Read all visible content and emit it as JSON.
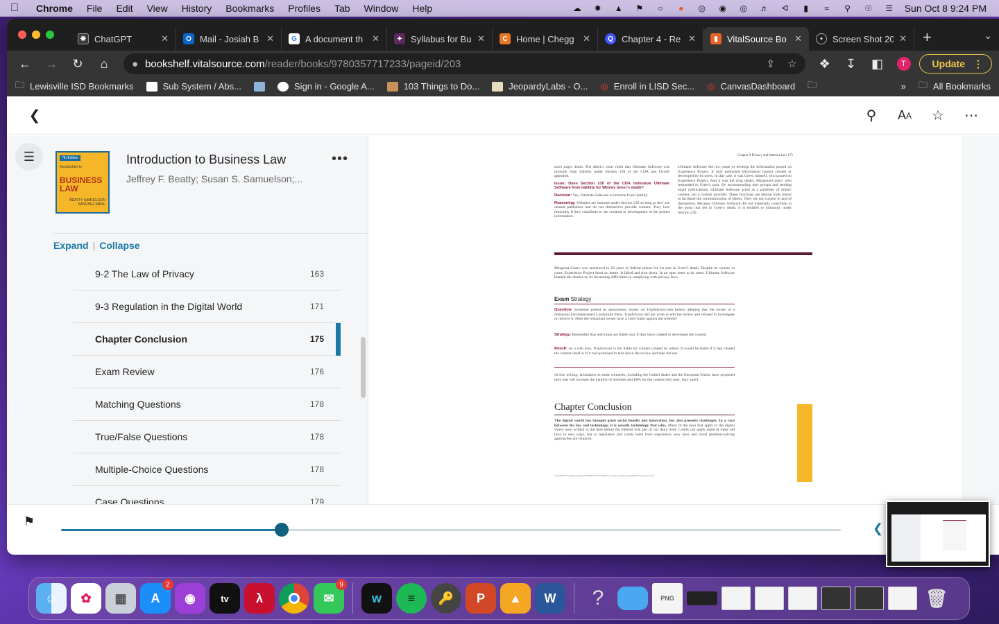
{
  "menubar": {
    "app_name": "Chrome",
    "items": [
      "File",
      "Edit",
      "View",
      "History",
      "Bookmarks",
      "Profiles",
      "Tab",
      "Window",
      "Help"
    ],
    "clock": "Sun Oct 8  9:24 PM"
  },
  "tabs": [
    {
      "title": "ChatGPT",
      "favicon": "chatgpt-icon",
      "color": "#444"
    },
    {
      "title": "Mail - Josiah B",
      "favicon": "outlook-icon",
      "color": "#0a64c9"
    },
    {
      "title": "A document th",
      "favicon": "google-icon",
      "color": "#fff"
    },
    {
      "title": "Syllabus for Bu",
      "favicon": "canvas-icon",
      "color": "#5a2a5e"
    },
    {
      "title": "Home | Chegg",
      "favicon": "chegg-icon",
      "color": "#e87722"
    },
    {
      "title": "Chapter 4 - Re",
      "favicon": "quizlet-icon",
      "color": "#4255ff"
    },
    {
      "title": "VitalSource Bo",
      "favicon": "vitalsource-icon",
      "color": "#e8622a"
    },
    {
      "title": "Screen Shot 20",
      "favicon": "globe-icon",
      "color": "#666"
    }
  ],
  "address": {
    "host": "bookshelf.vitalsource.com",
    "path": "/reader/books/9780357717233/pageid/203"
  },
  "profile_initial": "T",
  "update_label": "Update",
  "bookmarks": [
    {
      "label": "Lewisville ISD Bookmarks",
      "icon": "folder-icon"
    },
    {
      "label": "Sub System / Abs...",
      "icon": "substitute-icon"
    },
    {
      "label": "",
      "icon": "bookmark-app-icon"
    },
    {
      "label": "Sign in - Google A...",
      "icon": "google-icon"
    },
    {
      "label": "103 Things to Do...",
      "icon": "image-icon"
    },
    {
      "label": "JeopardyLabs - O...",
      "icon": "jeopardy-icon"
    },
    {
      "label": "Enroll in LISD Sec...",
      "icon": "dotted-circle-icon"
    },
    {
      "label": "CanvasDashboard",
      "icon": "dotted-circle-icon"
    },
    {
      "label": "",
      "icon": "folder-icon"
    }
  ],
  "bookmarks_more": "»",
  "all_bookmarks_label": "All Bookmarks",
  "book": {
    "title": "Introduction to Business Law",
    "authors": "Jeffrey F. Beatty; Susan S. Samuelson;...",
    "cover_edition": "7th Edition",
    "cover_sub": "Introduction to",
    "cover_title": "BUSINESS LAW",
    "cover_authors": "BEATTY SAMUELSON SÁNCHEZ ABRIL"
  },
  "toc_controls": {
    "expand": "Expand",
    "collapse": "Collapse",
    "separator": "|"
  },
  "toc": [
    {
      "label": "9-2 The Law of Privacy",
      "page": "163",
      "current": false
    },
    {
      "label": "9-3 Regulation in the Digital World",
      "page": "171",
      "current": false
    },
    {
      "label": "Chapter Conclusion",
      "page": "175",
      "current": true
    },
    {
      "label": "Exam Review",
      "page": "176",
      "current": false
    },
    {
      "label": "Matching Questions",
      "page": "178",
      "current": false
    },
    {
      "label": "True/False Questions",
      "page": "178",
      "current": false
    },
    {
      "label": "Multiple-Choice Questions",
      "page": "178",
      "current": false
    },
    {
      "label": "Case Questions",
      "page": "179",
      "current": false
    }
  ],
  "book_page": {
    "running_head": "Chapter 9    Privacy and Internet Law        175",
    "left_col_top": "son's tragic death. The district court ruled that Ultimate Software was immune from liability under Section 230 of the CDA and Dyroff appealed.",
    "issue_label": "Issue:",
    "issue_text": "Does Section 230 of the CDA immunize Ultimate Software from liability for Wesley Greer's death?",
    "decision_label": "Decision:",
    "decision_text": "Yes, Ultimate Software is immune from liability.",
    "reasoning_label": "Reasoning:",
    "reasoning_text": "Websites are immune under Section 230 so long as they are neutral publishers and do not themselves provide content. They lose immunity if they contribute to the creation or development of the posted information.",
    "right_col": "Ultimate Software did not create or develop the information posted on Experience Project. It only published information (posts) created or developed by its users. In this case, it was Greer, himself, who posted on Experience Project. And it was the drug dealer, Margenat-Castro, who responded to Greer's post. By recommending user groups and sending email notifications, Ultimate Software acted as a publisher of others' content, not a content provider. These functions are neutral tools meant to facilitate the communication of others. They are not content in and of themselves. Because Ultimate Software did not materially contribute to the posts that led to Greer's death, it is entitled to immunity under Section 230.",
    "post_case": "Margenat-Castro was sentenced to 20 years in federal prison for his part in Greer's death. Despite its victory in court, Experience Project fared no better: It failed and shut down. In an open letter to its users, Ultimate Software blamed the demise on its increasing difficulties in complying with privacy laws.",
    "exam_label": "Exam",
    "strategy_label": "Strategy",
    "question_label": "Question:",
    "question_text": "Someone posted an anonymous review on TripAdvisor.com falsely alleging that the owner of a restaurant had entertained a prostitute there. TripAdvisor did not write or edit the review and refused to investigate or remove it. Does the restaurant owner have a valid claim against the website?",
    "strategy_q_label": "Strategy:",
    "strategy_text": "Remember that web hosts are liable only if they have created or developed the content.",
    "result_label": "Result:",
    "result_text": "As a web host, TripAdvisor is not liable for content created by others. It would be liable if it had created the content itself or if it had promised to take down the review and then did not.",
    "writing_text": "At this writing, lawmakers in some countries, including the United States and the European Union, have proposed laws that will increase the liability of websites and ISPs for the content they post. Stay tuned.",
    "conclusion_title": "Chapter Conclusion",
    "conclusion_bold": "The digital world has brought great social benefit and innovation, but also presents challenges. In a race between the law and technology, it is usually technology that wins.",
    "conclusion_text": "Many of the laws that apply to the digital world were written in the time before the internet was part of our daily lives. Courts can apply some of these old laws in new ways, but as legislators and courts learn from experience, new laws and novel problem-solving approaches are required.",
    "copyright": "Copyright 2023 Cengage Learning. All Rights Reserved. May not be copied, scanned, or duplicated, in whole or in part."
  },
  "progress": {
    "fraction": 0.283
  },
  "accent_color": "#1b79a8",
  "dock": {
    "appstore_badge": "2",
    "messages_badge": "9"
  }
}
